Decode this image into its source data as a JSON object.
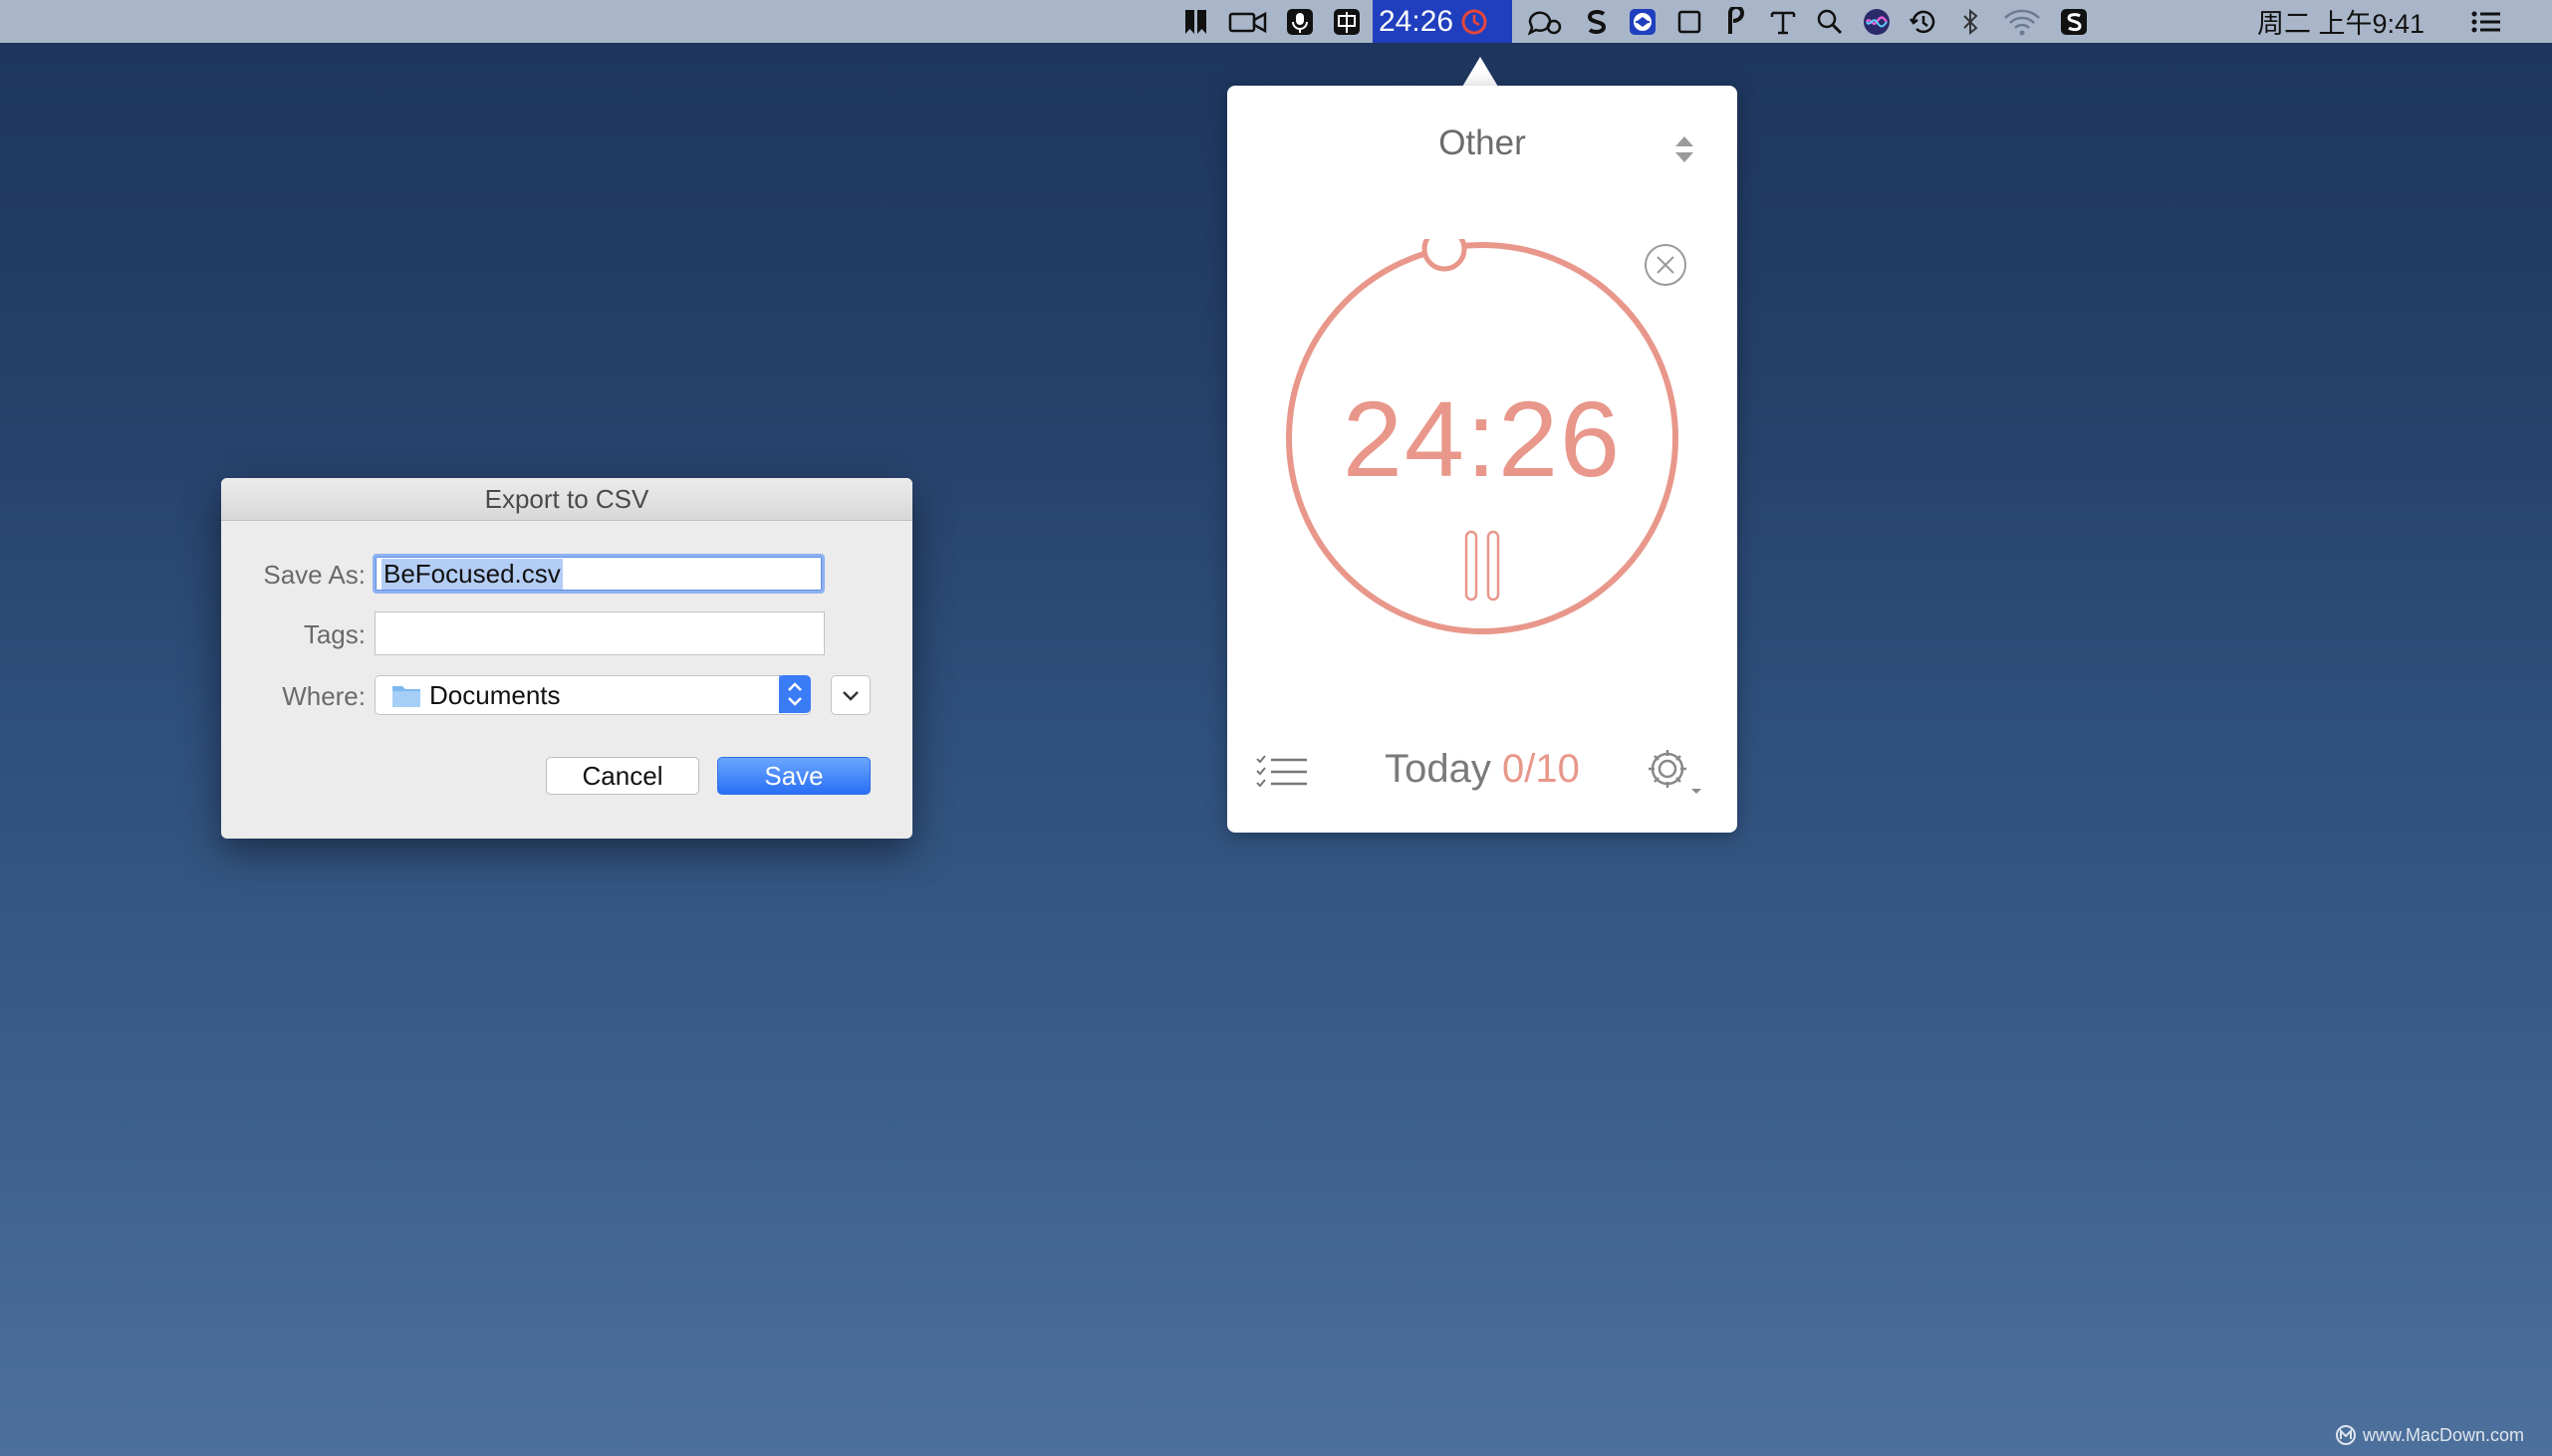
{
  "menubar": {
    "timer": "24:26",
    "clock": "周二 上午9:41"
  },
  "popover": {
    "category": "Other",
    "time": "24:26",
    "today_label": "Today",
    "today_count": "0/10",
    "accent_color": "#e8978a"
  },
  "dialog": {
    "title": "Export to CSV",
    "save_as_label": "Save As:",
    "save_as_value": "BeFocused.csv",
    "tags_label": "Tags:",
    "tags_value": "",
    "where_label": "Where:",
    "where_value": "Documents",
    "cancel_label": "Cancel",
    "save_label": "Save"
  },
  "watermark": "www.MacDown.com"
}
